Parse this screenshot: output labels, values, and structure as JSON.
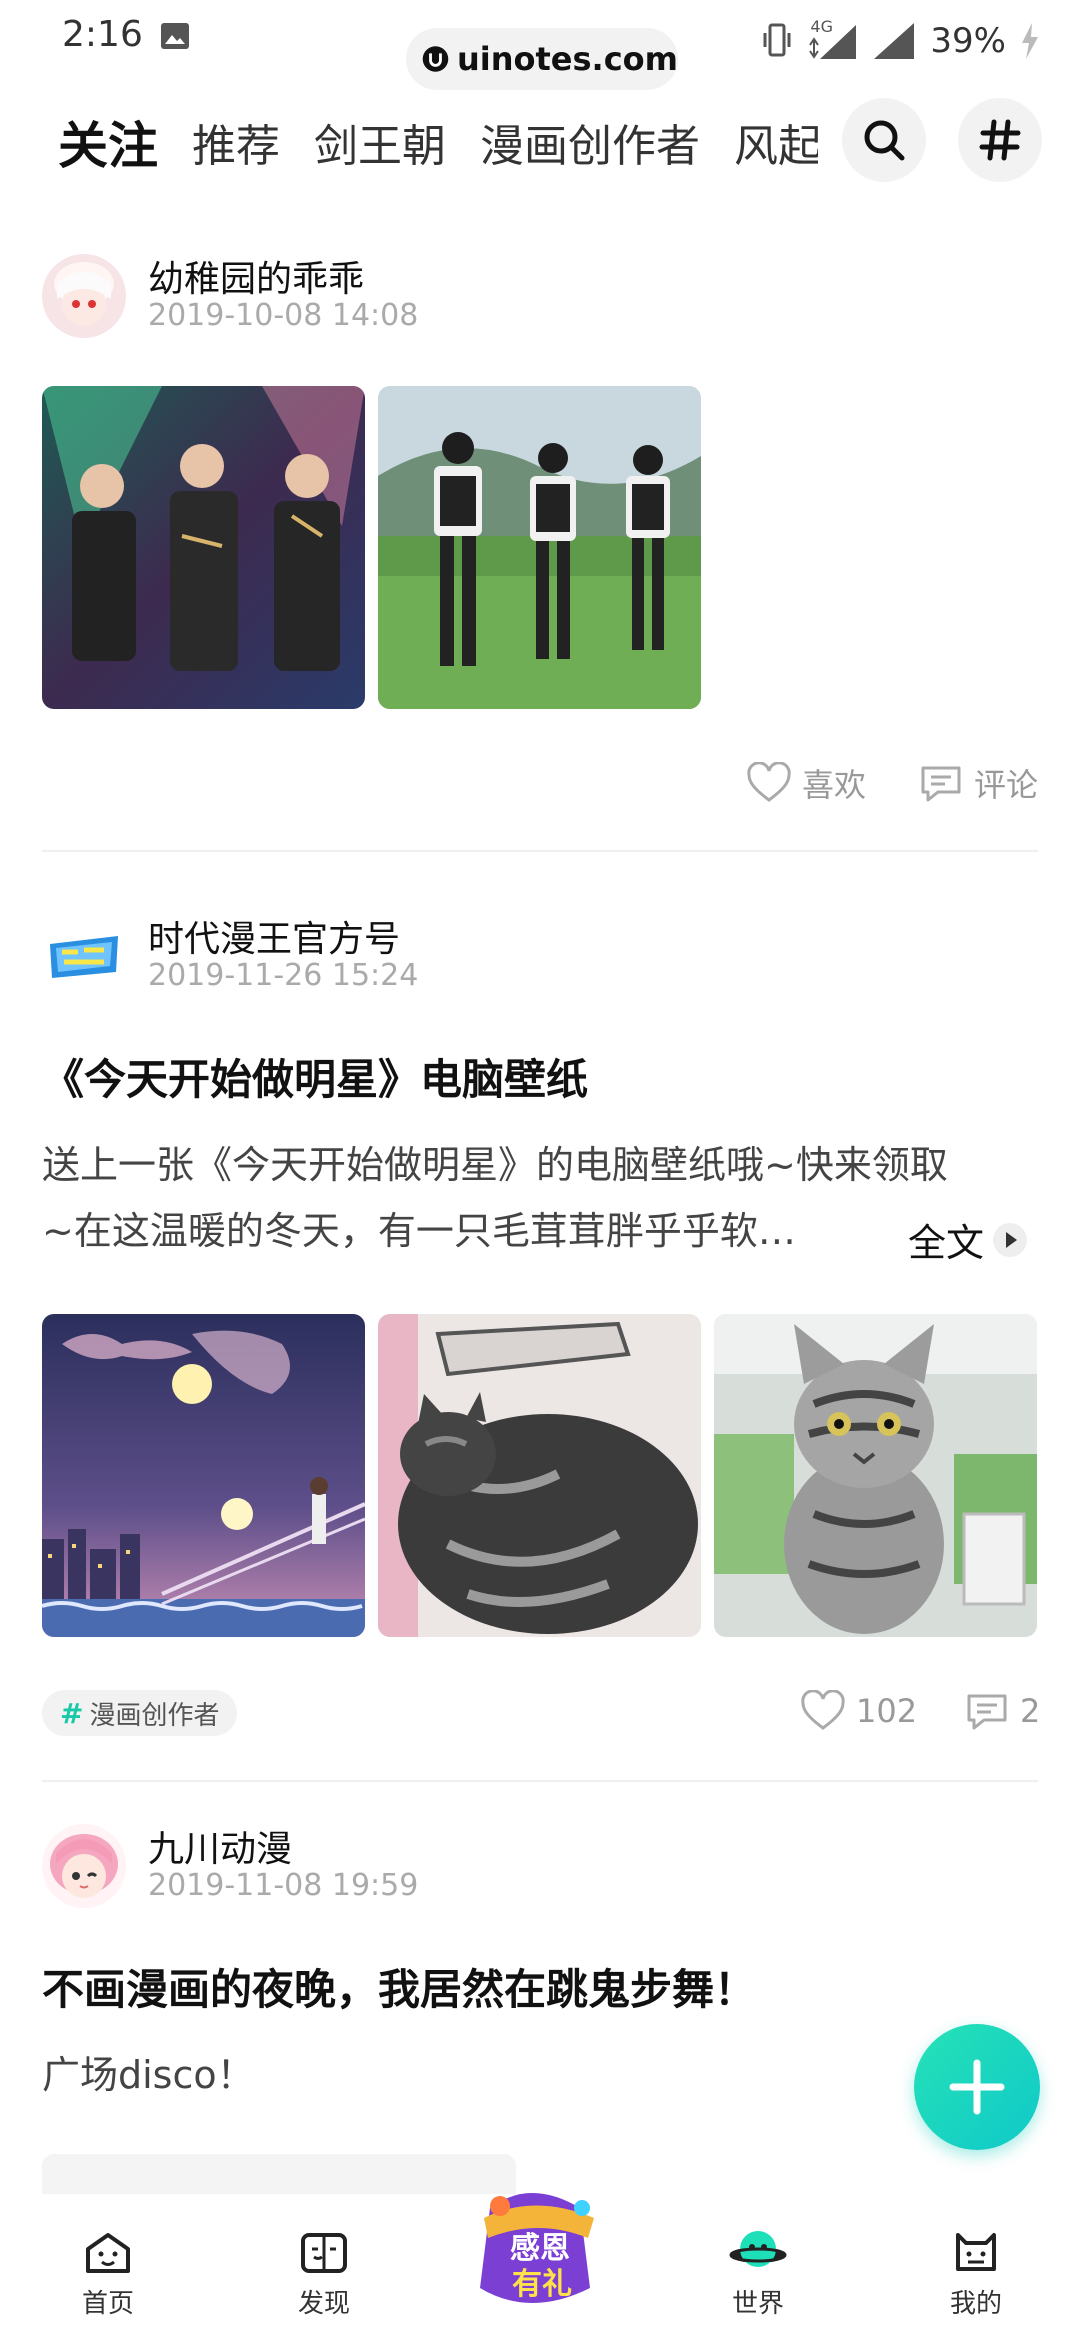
{
  "status_bar": {
    "time": "2:16",
    "watermark": "uinotes.com",
    "network": "4G",
    "battery": "39%"
  },
  "tabs": {
    "items": [
      "关注",
      "推荐",
      "剑王朝",
      "漫画创作者",
      "风起"
    ],
    "active_index": 0,
    "accent_color": "#19d3b8"
  },
  "posts": [
    {
      "author": "幼稚园的乖乖",
      "time": "2019-10-08 14:08",
      "images": [
        "stage-performance-photo",
        "boys-on-grass-photo"
      ],
      "like_label": "喜欢",
      "comment_label": "评论"
    },
    {
      "author": "时代漫王官方号",
      "time": "2019-11-26 15:24",
      "title": "《今天开始做明星》电脑壁纸",
      "body_line1": "送上一张《今天开始做明星》的电脑壁纸哦~快来领取",
      "body_line2": "~在这温暖的冬天，有一只毛茸茸胖乎乎软…",
      "full_text_label": "全文",
      "images": [
        "anime-night-scene",
        "sleeping-cat-photo",
        "tabby-cat-photo"
      ],
      "tag": "漫画创作者",
      "likes": "102",
      "comments": "2"
    },
    {
      "author": "九川动漫",
      "time": "2019-11-08 19:59",
      "title": "不画漫画的夜晚，我居然在跳鬼步舞！",
      "body": "广场disco！"
    }
  ],
  "promo": {
    "line1": "感恩",
    "line2": "有礼"
  },
  "bottom_nav": [
    "首页",
    "发现",
    "世界",
    "我的"
  ]
}
